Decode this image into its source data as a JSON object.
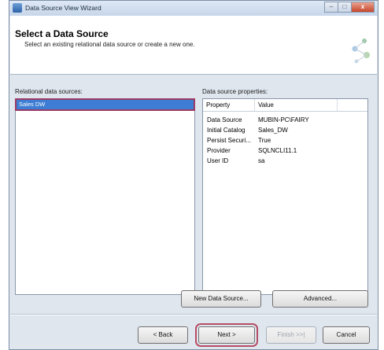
{
  "window": {
    "title": "Data Source View Wizard",
    "controls": {
      "minimize": "–",
      "maximize": "□",
      "close": "x"
    }
  },
  "header": {
    "title": "Select a Data Source",
    "subtitle": "Select an existing relational data source or create a new one."
  },
  "relational_sources": {
    "label": "Relational data sources:",
    "items": [
      "Sales DW"
    ]
  },
  "properties": {
    "label": "Data source properties:",
    "columns": [
      "Property",
      "Value"
    ],
    "rows": [
      {
        "property": "Data Source",
        "value": "MUBIN-PC\\FAIRY"
      },
      {
        "property": "Initial Catalog",
        "value": "Sales_DW"
      },
      {
        "property": "Persist Securi...",
        "value": "True"
      },
      {
        "property": "Provider",
        "value": "SQLNCLI11.1"
      },
      {
        "property": "User ID",
        "value": "sa"
      }
    ]
  },
  "buttons": {
    "new_data_source": "New Data Source...",
    "advanced": "Advanced...",
    "back": "< Back",
    "next": "Next >",
    "finish": "Finish >>|",
    "cancel": "Cancel"
  },
  "colors": {
    "selection": "#3d7dd3",
    "highlight_outline": "#b64d65",
    "window_body": "#dfe6ee"
  }
}
